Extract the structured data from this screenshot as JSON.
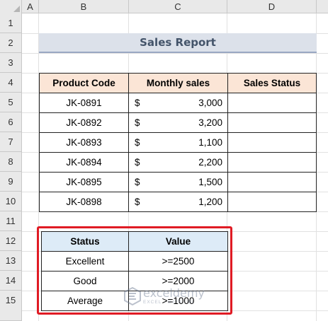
{
  "columns": [
    "A",
    "B",
    "C",
    "D"
  ],
  "rows": [
    "1",
    "2",
    "3",
    "4",
    "5",
    "6",
    "7",
    "8",
    "9",
    "10",
    "11",
    "12",
    "13",
    "14",
    "15"
  ],
  "title": "Sales Report",
  "sales_table": {
    "headers": [
      "Product Code",
      "Monthly sales",
      "Sales Status"
    ],
    "currency": "$",
    "rows": [
      {
        "code": "JK-0891",
        "sales": "3,000",
        "status": ""
      },
      {
        "code": "JK-0892",
        "sales": "3,200",
        "status": ""
      },
      {
        "code": "JK-0893",
        "sales": "1,100",
        "status": ""
      },
      {
        "code": "JK-0894",
        "sales": "2,200",
        "status": ""
      },
      {
        "code": "JK-0895",
        "sales": "1,500",
        "status": ""
      },
      {
        "code": "JK-0898",
        "sales": "1,200",
        "status": ""
      }
    ]
  },
  "criteria_table": {
    "headers": [
      "Status",
      "Value"
    ],
    "rows": [
      {
        "status": "Excellent",
        "value": ">=2500"
      },
      {
        "status": "Good",
        "value": ">=2000"
      },
      {
        "status": "Average",
        "value": ">=1000"
      }
    ]
  },
  "watermark": {
    "name": "exceldemy",
    "tagline": "EXCEL · DATA · BI"
  },
  "colors": {
    "title_fill": "#dce1ea",
    "title_text": "#44546a",
    "sales_header_fill": "#fbe5d6",
    "criteria_header_fill": "#ddebf7",
    "highlight_border": "#e01b24"
  }
}
